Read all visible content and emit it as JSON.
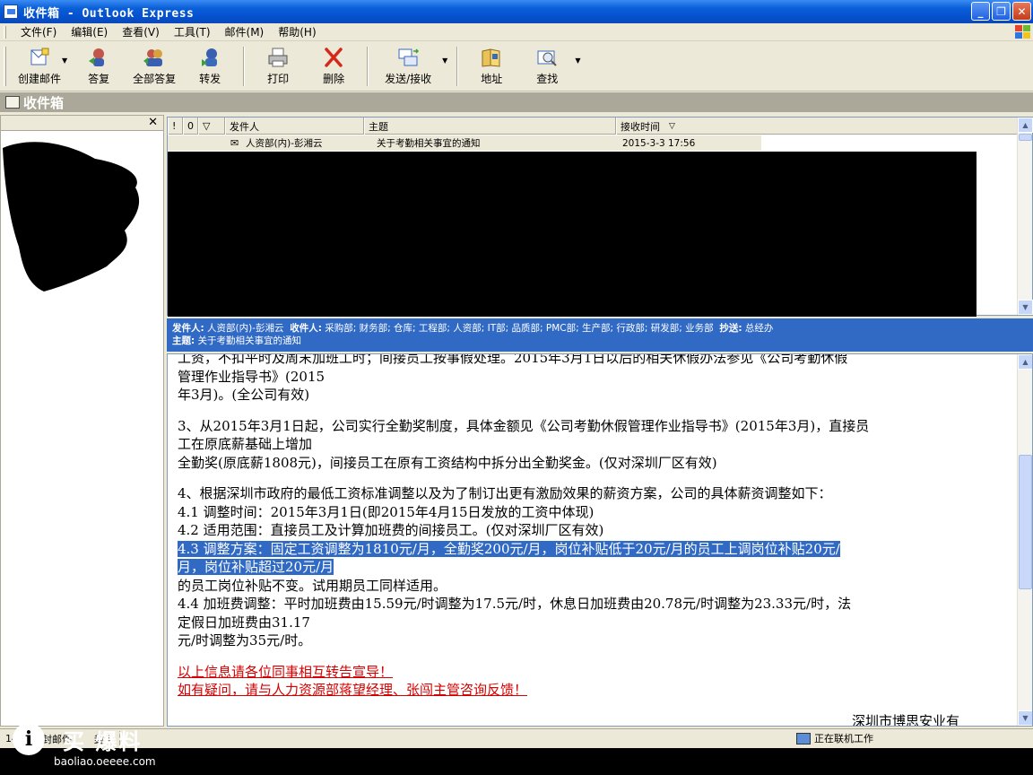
{
  "window": {
    "title": "收件箱 - Outlook Express",
    "controls": [
      "_",
      "❐",
      "✕"
    ]
  },
  "menu": [
    "文件(F)",
    "编辑(E)",
    "查看(V)",
    "工具(T)",
    "邮件(M)",
    "帮助(H)"
  ],
  "toolbar": {
    "new_mail": "创建邮件",
    "reply": "答复",
    "reply_all": "全部答复",
    "forward": "转发",
    "print": "打印",
    "delete": "删除",
    "send_receive": "发送/接收",
    "addresses": "地址",
    "find": "查找"
  },
  "folder": {
    "name": "收件箱"
  },
  "left_pane": {
    "close": "✕"
  },
  "message_list": {
    "columns": {
      "priority": "!",
      "attach": "0",
      "flag": "▽",
      "from": "发件人",
      "subject": "主题",
      "received": "接收时间"
    },
    "messages": [
      {
        "from": "人资部(内)-彭湘云",
        "subject": "关于考勤相关事宜的通知",
        "received": "2015-3-3 17:56"
      }
    ]
  },
  "preview_header": {
    "from_label": "发件人:",
    "from": "人资部(内)-彭湘云",
    "to_label": "收件人:",
    "to": "采购部; 财务部; 仓库; 工程部; 人资部; IT部; 品质部; PMC部; 生产部; 行政部; 研发部; 业务部",
    "cc_label": "抄送:",
    "cc": "总经办",
    "subject_label": "主题:",
    "subject": "关于考勤相关事宜的通知"
  },
  "preview_body": {
    "line1": "  工资，不扣平时及周末加班工时；间接员工按事假处理。2015年3月1日以后的相关休假办法参见《公司考勤休假",
    "line2": "管理作业指导书》(2015",
    "line3": "    年3月)。(全公司有效)",
    "line4": "3、从2015年3月1日起，公司实行全勤奖制度，具体金额见《公司考勤休假管理作业指导书》(2015年3月)，直接员",
    "line5": "工在原底薪基础上增加",
    "line6": "    全勤奖(原底薪1808元)，间接员工在原有工资结构中拆分出全勤奖金。(仅对深圳厂区有效)",
    "line7": "4、根据深圳市政府的最低工资标准调整以及为了制订出更有激励效果的薪资方案，公司的具体薪资调整如下：",
    "line8": "    4.1 调整时间：2015年3月1日(即2015年4月15日发放的工资中体现)",
    "line9": "    4.2 适用范围：直接员工及计算加班费的间接员工。(仅对深圳厂区有效)",
    "line10": "    4.3 调整方案：固定工资调整为1810元/月，全勤奖200元/月，岗位补贴低于20元/月的员工上调岗位补贴20元/",
    "line11": "月，岗位补贴超过20元/月",
    "line12": "          的员工岗位补贴不变。试用期员工同样适用。",
    "line13": "    4.4 加班费调整：平时加班费由15.59元/时调整为17.5元/时，休息日加班费由20.78元/时调整为23.33元/时，法",
    "line14": "定假日加班费由31.17",
    "line15": "          元/时调整为35元/时。",
    "notice1": "以上信息请各位同事相互转告宣导！",
    "notice2": "如有疑问，请与人力资源部蒋望经理、张闯主管咨询反馈！",
    "signature": "深圳市博思安业有"
  },
  "status": {
    "count": "140",
    "unread": "封邮件，",
    "extra": "封未",
    "online": "正在联机工作"
  },
  "watermark": {
    "logo": "i",
    "text": "买 爆料",
    "url": "baoliao.oeeee.com"
  },
  "colors": {
    "titlebar": "#0a5fd8",
    "highlight": "#316ac5",
    "notice": "#d40000"
  }
}
